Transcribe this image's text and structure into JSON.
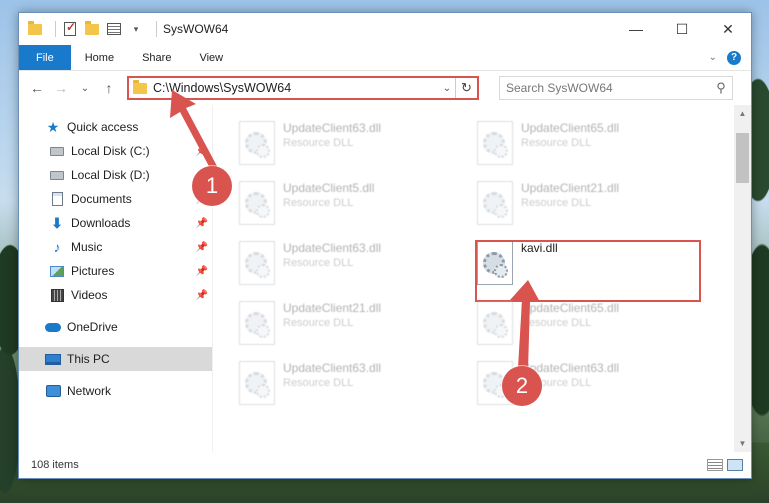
{
  "window": {
    "title": "SysWOW64",
    "controls": {
      "minimize": "—",
      "maximize": "☐",
      "close": "✕"
    }
  },
  "ribbon": {
    "tabs": [
      "File",
      "Home",
      "Share",
      "View"
    ],
    "help": "?",
    "collapse": "⌄"
  },
  "navbar": {
    "back": "←",
    "forward": "→",
    "recent": "⌄",
    "up": "↑",
    "address": "C:\\Windows\\SysWOW64",
    "refresh": "↻",
    "search_placeholder": "Search SysWOW64",
    "search_icon": "search-icon"
  },
  "sidebar": {
    "items": [
      {
        "label": "Quick access",
        "icon": "star-icon"
      },
      {
        "label": "Local Disk (C:)",
        "icon": "drive-icon",
        "pinned": true
      },
      {
        "label": "Local Disk (D:)",
        "icon": "drive-icon",
        "pinned": true
      },
      {
        "label": "Documents",
        "icon": "documents-icon",
        "pinned": true
      },
      {
        "label": "Downloads",
        "icon": "downloads-icon",
        "pinned": true
      },
      {
        "label": "Music",
        "icon": "music-icon",
        "pinned": true
      },
      {
        "label": "Pictures",
        "icon": "pictures-icon",
        "pinned": true
      },
      {
        "label": "Videos",
        "icon": "videos-icon",
        "pinned": true
      },
      {
        "label": "OneDrive",
        "icon": "onedrive-icon"
      },
      {
        "label": "This PC",
        "icon": "this-pc-icon",
        "selected": true
      },
      {
        "label": "Network",
        "icon": "network-icon"
      }
    ]
  },
  "files": [
    {
      "name": "UpdateClient63.dll",
      "type": "Resource DLL"
    },
    {
      "name": "UpdateClient65.dll",
      "type": "Resource DLL"
    },
    {
      "name": "UpdateClient5.dll",
      "type": "Resource DLL"
    },
    {
      "name": "UpdateClient21.dll",
      "type": "Resource DLL"
    },
    {
      "name": "UpdateClient63.dll",
      "type": "Resource DLL"
    },
    {
      "name": "kavi.dll",
      "type": ""
    },
    {
      "name": "UpdateClient21.dll",
      "type": "Resource DLL"
    },
    {
      "name": "UpdateClient65.dll",
      "type": "Resource DLL"
    },
    {
      "name": "UpdateClient63.dll",
      "type": "Resource DLL"
    },
    {
      "name": "UpdateClient63.dll",
      "type": "Resource DLL"
    }
  ],
  "status": {
    "item_count": "108 items"
  },
  "callouts": [
    "1",
    "2"
  ],
  "colors": {
    "accent": "#1979ca",
    "callout_red": "#d9534f"
  }
}
